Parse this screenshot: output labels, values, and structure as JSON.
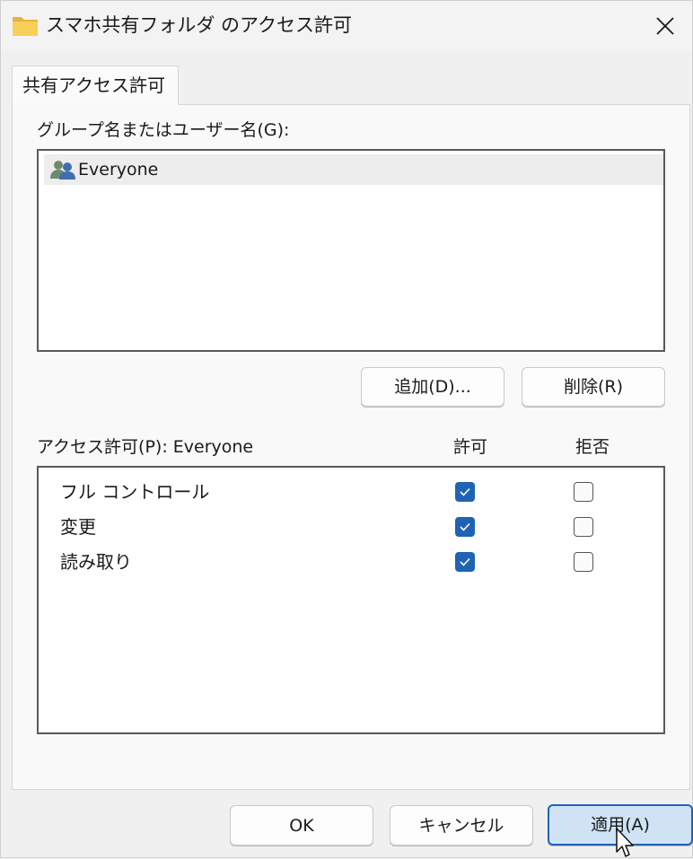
{
  "window": {
    "title": "スマホ共有フォルダ のアクセス許可",
    "folder_icon": "folder-icon",
    "close_icon": "close-icon",
    "accent_color": "#1f63b5",
    "folder_color": "#f5c84c"
  },
  "tabs": [
    {
      "label": "共有アクセス許可",
      "selected": true
    }
  ],
  "groups": {
    "label": "グループ名またはユーザー名(G):",
    "items": [
      {
        "name": "Everyone",
        "icon": "users-icon",
        "selected": true
      }
    ],
    "add_button": "追加(D)...",
    "remove_button": "削除(R)"
  },
  "permissions": {
    "label": "アクセス許可(P): Everyone",
    "allow_header": "許可",
    "deny_header": "拒否",
    "rows": [
      {
        "name": "フル コントロール",
        "allow": true,
        "deny": false
      },
      {
        "name": "変更",
        "allow": true,
        "deny": false
      },
      {
        "name": "読み取り",
        "allow": true,
        "deny": false
      }
    ]
  },
  "footer": {
    "ok": "OK",
    "cancel": "キャンセル",
    "apply": "適用(A)"
  }
}
